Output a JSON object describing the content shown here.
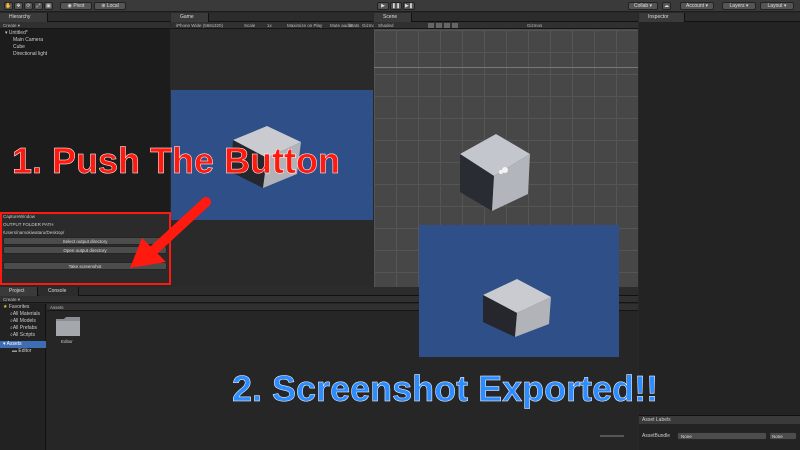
{
  "toolbar": {
    "pivot": "Pivot",
    "local": "Local",
    "collab": "Collab",
    "account": "Account",
    "layers": "Layers",
    "layout": "Layout"
  },
  "hierarchy": {
    "tab": "Hierarchy",
    "create": "Create",
    "scene": "Untitled*",
    "items": [
      "Main Camera",
      "Cube",
      "Directional light"
    ]
  },
  "game": {
    "tab": "Game",
    "display": "iPhone Wide (568x320)",
    "scale_label": "Scale",
    "scale_value": "1x",
    "maximize": "Maximize on Play",
    "mute": "Mute audio",
    "stats": "Stats",
    "gizmos": "Gizmos"
  },
  "scene": {
    "tab": "Scene",
    "shading": "Shaded",
    "gizmos": "Gizmos"
  },
  "capture": {
    "title": "CaptureWindow",
    "folder_label": "OUTPUT FOLDER PATH",
    "path": "/Users/namokiwataru/Desktop/",
    "select_button": "Select output directory",
    "open_button": "Open output directory",
    "take_button": "Take screenshot"
  },
  "project": {
    "tab": "Project",
    "console_tab": "Console",
    "create": "Create",
    "favorites": "Favorites",
    "favorite_items": [
      "All Materials",
      "All Models",
      "All Prefabs",
      "All Scripts"
    ],
    "assets": "Assets",
    "editor": "Editor",
    "breadcrumb": "Assets",
    "folder_label": "Editor"
  },
  "inspector": {
    "tab": "Inspector",
    "asset_labels": "Asset Labels",
    "asset_bundle": "AssetBundle",
    "bundle_value": "None",
    "variant_value": "None"
  },
  "annotations": {
    "step1": "1. Push The Button",
    "step2": "2. Screenshot Exported!!"
  },
  "colors": {
    "callout_red": "#ff1a10",
    "callout_blue": "#2d8cff",
    "game_bg": "#2e4f87"
  }
}
